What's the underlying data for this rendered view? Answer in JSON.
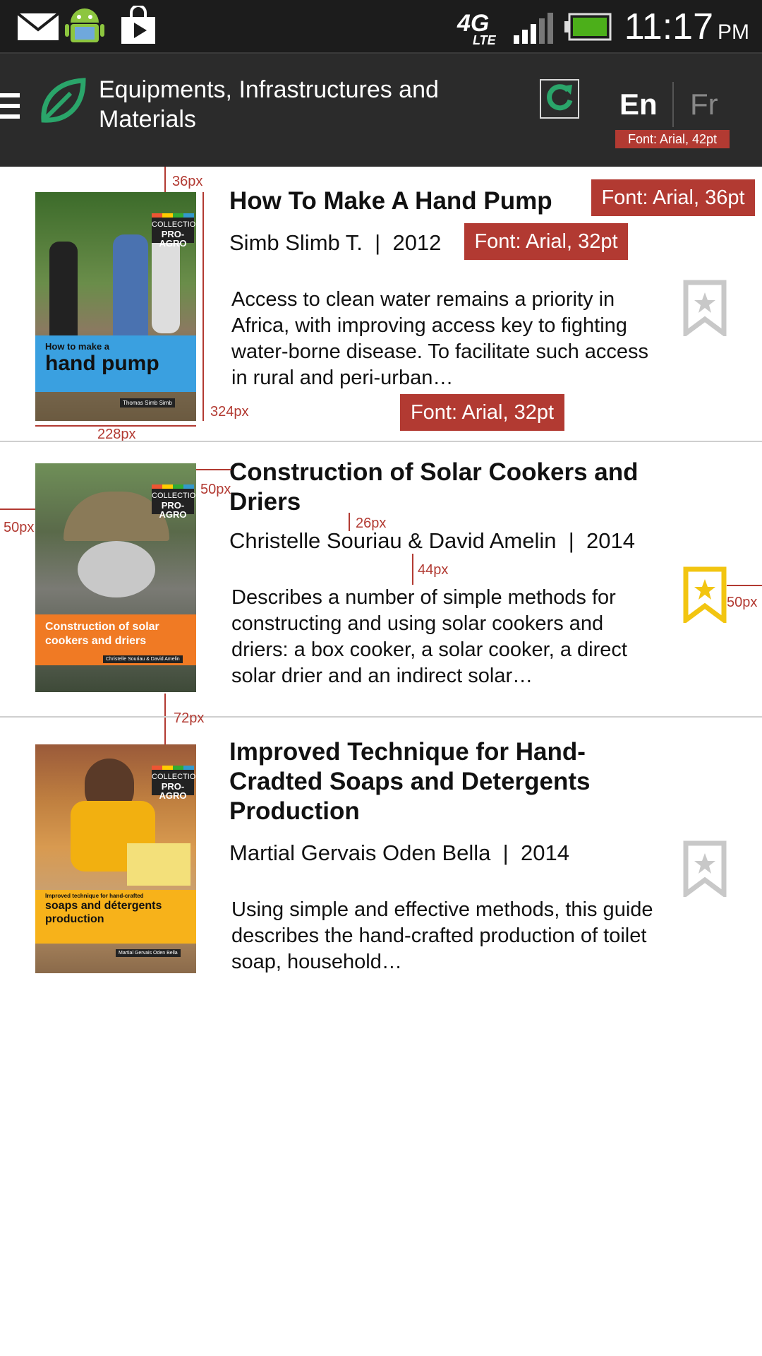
{
  "status_bar": {
    "time": "11:17",
    "ampm": "PM",
    "network": "4G",
    "network_sub": "LTE",
    "icons": [
      "mail-icon",
      "android-icon",
      "play-store-icon",
      "signal-icon",
      "battery-icon"
    ]
  },
  "app_bar": {
    "title": "Equipments, Infrastructures and Materials",
    "lang_en": "En",
    "lang_fr": "Fr",
    "icons": [
      "menu-icon",
      "leaf-icon",
      "refresh-icon"
    ],
    "accent": "#2aa56a"
  },
  "annotations": {
    "header_font": "Font: Arial, 42pt",
    "title_font": "Font: Arial, 36pt",
    "meta_font": "Font: Arial, 32pt",
    "desc_font": "Font: Arial, 32pt",
    "dim_36": "36px",
    "dim_324": "324px",
    "dim_228": "228px",
    "dim_50_a": "50px",
    "dim_50_b": "50px",
    "dim_26": "26px",
    "dim_44": "44px",
    "dim_50_c": "50px",
    "dim_72": "72px",
    "color": "#b23a32"
  },
  "books": [
    {
      "title": "How To Make A Hand Pump",
      "author": "Simb Slimb T.",
      "year": "2012",
      "separator": "|",
      "description": "Access to clean water remains a priority in Africa, with improving access key to fighting water-borne disease. To facilitate such access in rural and peri-urban…",
      "cover_small": "How to make a",
      "cover_big": "hand pump",
      "cover_author": "Thomas Simb Simb",
      "collection": "COLLECTION",
      "collection_name": "PRO-AGRO",
      "bookmarked": false
    },
    {
      "title": "Construction of Solar Cookers and Driers",
      "author": "Christelle Souriau & David Amelin",
      "year": "2014",
      "separator": "|",
      "description": "Describes a number of simple methods for constructing and using solar cookers and driers: a box cooker, a solar cooker, a direct solar drier and an indirect solar…",
      "cover_big": "Construction of solar cookers and driers",
      "cover_author": "Christelle Souriau & David Amelin",
      "collection": "COLLECTION",
      "collection_name": "PRO-AGRO",
      "bookmarked": true
    },
    {
      "title": "Improved Technique for Hand-Cradted Soaps and Detergents Production",
      "author": "Martial Gervais Oden Bella",
      "year": "2014",
      "separator": "|",
      "description": "Using simple and effective methods, this guide describes the hand-crafted production of toilet soap, household…",
      "cover_small": "Improved technique for hand-crafted",
      "cover_big": "soaps and détergents production",
      "cover_author": "Martial Gervais Oden Bella",
      "collection": "COLLECTION",
      "collection_name": "PRO-AGRO",
      "bookmarked": false
    }
  ],
  "colors": {
    "bookmark_active": "#f2c511",
    "bookmark_inactive": "#c8c8c8"
  }
}
